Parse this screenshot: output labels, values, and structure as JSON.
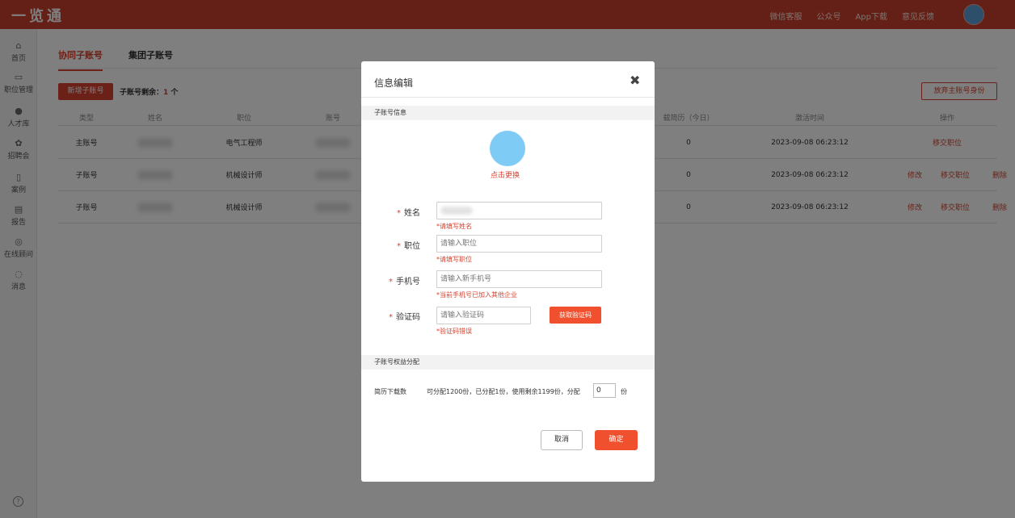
{
  "app": {
    "logo": "一览通"
  },
  "topnav": [
    "微信客服",
    "公众号",
    "App下载",
    "意见反馈"
  ],
  "sidebar": {
    "items": [
      {
        "label": "首页",
        "icon": "home-icon"
      },
      {
        "label": "职位管理",
        "icon": "briefcase-icon"
      },
      {
        "label": "人才库",
        "icon": "person-icon"
      },
      {
        "label": "招聘会",
        "icon": "fair-icon"
      },
      {
        "label": "案例",
        "icon": "book-icon"
      },
      {
        "label": "报告",
        "icon": "report-icon"
      },
      {
        "label": "在线顾问",
        "icon": "consultant-icon"
      },
      {
        "label": "消息",
        "icon": "message-icon"
      }
    ],
    "help_icon": "help-icon"
  },
  "main": {
    "tabs": [
      {
        "label": "协同子账号",
        "active": true
      },
      {
        "label": "集团子账号",
        "active": false
      }
    ],
    "new_button": "新增子账号",
    "remain_label": "子账号剩余：",
    "remain_count": "1",
    "remain_unit": " 个",
    "abandon_button": "放弃主账号身份",
    "table": {
      "headers": [
        "类型",
        "姓名",
        "职位",
        "账号",
        "载简历（今日）",
        "激活时间",
        "操作"
      ],
      "rows": [
        {
          "type": "主账号",
          "position": "电气工程师",
          "downloads": "0",
          "activated": "2023-09-08 06:23:12",
          "ops": [
            "移交职位"
          ]
        },
        {
          "type": "子账号",
          "position": "机械设计师",
          "downloads": "0",
          "activated": "2023-09-08 06:23:12",
          "ops": [
            "修改",
            "移交职位",
            "删除"
          ]
        },
        {
          "type": "子账号",
          "position": "机械设计师",
          "downloads": "0",
          "activated": "2023-09-08 06:23:12",
          "ops": [
            "修改",
            "移交职位",
            "删除"
          ]
        }
      ]
    }
  },
  "modal": {
    "title": "信息编辑",
    "section_info": "子账号信息",
    "avatar_change": "点击更换",
    "fields": {
      "name": {
        "label": "姓名",
        "value": "",
        "error": "*请填写姓名"
      },
      "position": {
        "label": "职位",
        "placeholder": "请输入职位",
        "error": "*请填写职位"
      },
      "phone": {
        "label": "手机号",
        "placeholder": "请输入新手机号",
        "error": "*当前手机号已加入其他企业"
      },
      "code": {
        "label": "验证码",
        "placeholder": "请输入验证码",
        "error": "*验证码错误",
        "button": "获取验证码"
      }
    },
    "section_rights": "子账号权益分配",
    "rights": {
      "label": "简历下载数",
      "text": "可分配1200份，已分配1份，使用剩余1199份，分配",
      "value": "0",
      "unit": "份"
    },
    "cancel": "取消",
    "confirm": "确定"
  },
  "colors": {
    "brand": "#c9402d",
    "accent": "#d7432f",
    "button": "#f0502d"
  }
}
